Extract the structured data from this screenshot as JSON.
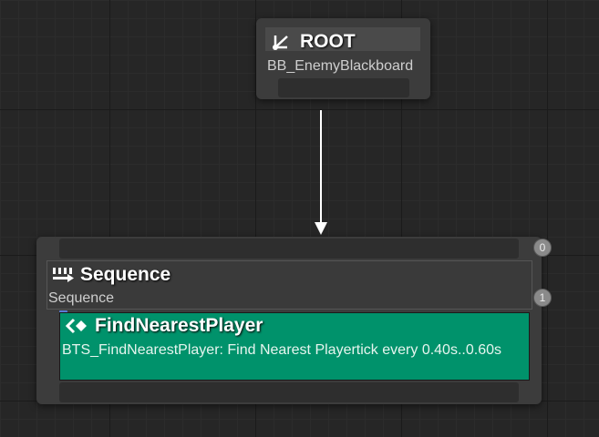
{
  "root_node": {
    "title": "ROOT",
    "blackboard": "BB_EnemyBlackboard",
    "icon": "root-icon"
  },
  "sequence_node": {
    "title": "Sequence",
    "subtitle": "Sequence",
    "icon": "sequence-icon",
    "index_top": "0",
    "index_body": "1"
  },
  "service_node": {
    "title": "FindNearestPlayer",
    "description": "BTS_FindNearestPlayer: Find Nearest Playertick every 0.40s..0.60s",
    "icon": "service-icon",
    "color": "#00926b"
  },
  "colors": {
    "graph_bg": "#262626",
    "node_bg": "#3c3c3c",
    "connector": "#ffffff"
  }
}
